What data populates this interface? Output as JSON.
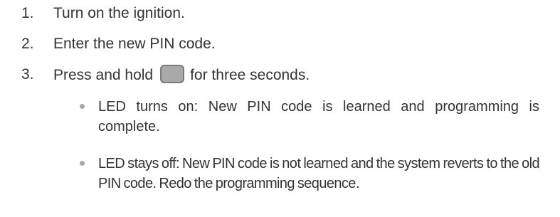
{
  "steps": [
    {
      "number": "1.",
      "text": "Turn on the ignition."
    },
    {
      "number": "2.",
      "text": "Enter the new PIN code."
    },
    {
      "number": "3.",
      "text_before_icon": "Press and hold",
      "icon": "rounded-square-key-icon",
      "text_after_icon": "for three seconds."
    }
  ],
  "outcomes": [
    {
      "text": "LED turns on: New PIN code is learned and programming is complete."
    },
    {
      "text": "LED stays off: New PIN code is not learned and the system reverts to the old PIN code. Redo the programming sequence."
    }
  ],
  "colors": {
    "text": "#333333",
    "bullet": "#a7a7a7",
    "key_fill": "#a9a9a9",
    "key_border": "#7a7a7a"
  }
}
